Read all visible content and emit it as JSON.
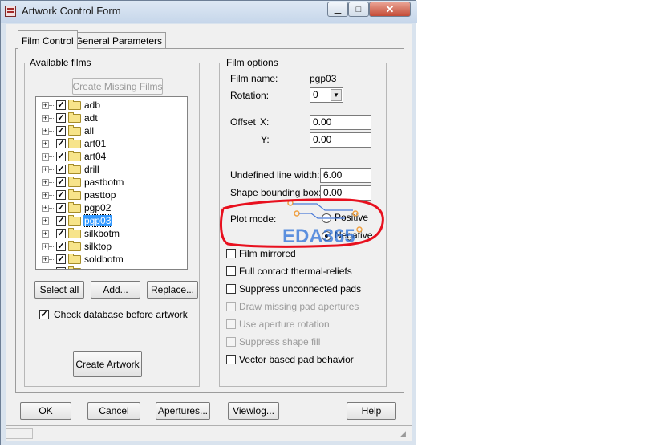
{
  "window": {
    "title": "Artwork Control Form",
    "min_label": "▁",
    "max_label": "□",
    "close_label": "✕"
  },
  "tabs": [
    {
      "label": "Film Control"
    },
    {
      "label": "General Parameters"
    }
  ],
  "available_films": {
    "legend": "Available films",
    "create_missing_label": "Create Missing Films",
    "items": [
      {
        "label": "adb",
        "checked": true
      },
      {
        "label": "adt",
        "checked": true
      },
      {
        "label": "all",
        "checked": true
      },
      {
        "label": "art01",
        "checked": true
      },
      {
        "label": "art04",
        "checked": true
      },
      {
        "label": "drill",
        "checked": true
      },
      {
        "label": "pastbotm",
        "checked": true
      },
      {
        "label": "pasttop",
        "checked": true
      },
      {
        "label": "pgp02",
        "checked": true
      },
      {
        "label": "pgp03",
        "checked": true,
        "selected": true
      },
      {
        "label": "silkbotm",
        "checked": true
      },
      {
        "label": "silktop",
        "checked": true
      },
      {
        "label": "soldbotm",
        "checked": true
      }
    ],
    "select_all_label": "Select all",
    "add_label": "Add...",
    "replace_label": "Replace...",
    "check_db_label": "Check database before artwork",
    "check_db_checked": true,
    "create_artwork_label": "Create Artwork"
  },
  "film_options": {
    "legend": "Film options",
    "film_name_label": "Film name:",
    "film_name_value": "pgp03",
    "rotation_label": "Rotation:",
    "rotation_value": "0",
    "offset_label": "Offset",
    "x_label": "X:",
    "x_value": "0.00",
    "y_label": "Y:",
    "y_value": "0.00",
    "undefined_line_width_label": "Undefined line width:",
    "undefined_line_width_value": "6.00",
    "shape_bounding_box_label": "Shape bounding box:",
    "shape_bounding_box_value": "0.00",
    "plot_mode_label": "Plot mode:",
    "positive_label": "Positive",
    "negative_label": "Negative",
    "plot_mode_selected": "Negative",
    "checkboxes": [
      {
        "label": "Film mirrored",
        "checked": false,
        "enabled": true
      },
      {
        "label": "Full contact thermal-reliefs",
        "checked": false,
        "enabled": true
      },
      {
        "label": "Suppress unconnected pads",
        "checked": false,
        "enabled": true
      },
      {
        "label": "Draw missing pad apertures",
        "checked": false,
        "enabled": false
      },
      {
        "label": "Use aperture rotation",
        "checked": false,
        "enabled": false
      },
      {
        "label": "Suppress shape fill",
        "checked": false,
        "enabled": false
      },
      {
        "label": "Vector based pad behavior",
        "checked": false,
        "enabled": true
      }
    ]
  },
  "watermark": {
    "text": "EDA365",
    "color": "#2a6fd8",
    "accent": "#f0a040"
  },
  "annotation": {
    "color": "#e8101e"
  },
  "bottom_buttons": {
    "ok": "OK",
    "cancel": "Cancel",
    "apertures": "Apertures...",
    "viewlog": "Viewlog...",
    "help": "Help"
  }
}
